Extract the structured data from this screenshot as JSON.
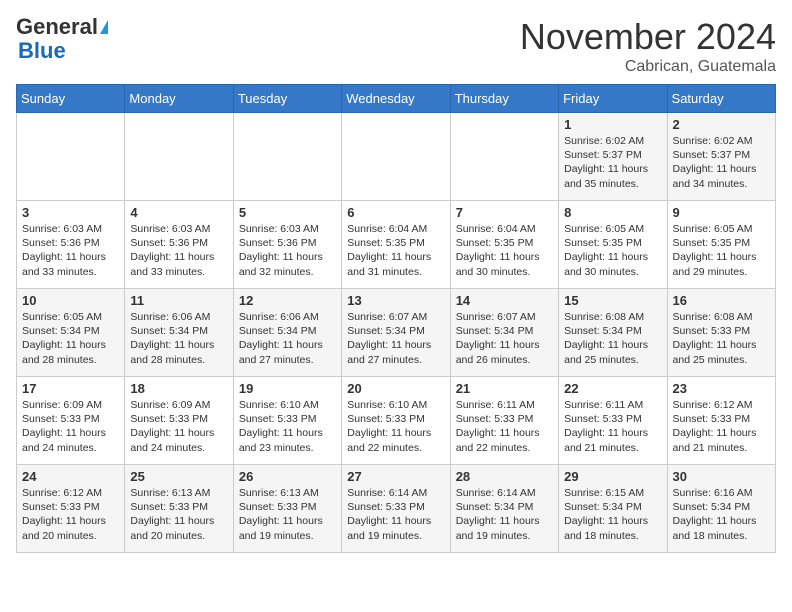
{
  "logo": {
    "general": "General",
    "blue": "Blue"
  },
  "header": {
    "month": "November 2024",
    "location": "Cabrican, Guatemala"
  },
  "weekdays": [
    "Sunday",
    "Monday",
    "Tuesday",
    "Wednesday",
    "Thursday",
    "Friday",
    "Saturday"
  ],
  "weeks": [
    [
      {
        "day": "",
        "info": ""
      },
      {
        "day": "",
        "info": ""
      },
      {
        "day": "",
        "info": ""
      },
      {
        "day": "",
        "info": ""
      },
      {
        "day": "",
        "info": ""
      },
      {
        "day": "1",
        "info": "Sunrise: 6:02 AM\nSunset: 5:37 PM\nDaylight: 11 hours and 35 minutes."
      },
      {
        "day": "2",
        "info": "Sunrise: 6:02 AM\nSunset: 5:37 PM\nDaylight: 11 hours and 34 minutes."
      }
    ],
    [
      {
        "day": "3",
        "info": "Sunrise: 6:03 AM\nSunset: 5:36 PM\nDaylight: 11 hours and 33 minutes."
      },
      {
        "day": "4",
        "info": "Sunrise: 6:03 AM\nSunset: 5:36 PM\nDaylight: 11 hours and 33 minutes."
      },
      {
        "day": "5",
        "info": "Sunrise: 6:03 AM\nSunset: 5:36 PM\nDaylight: 11 hours and 32 minutes."
      },
      {
        "day": "6",
        "info": "Sunrise: 6:04 AM\nSunset: 5:35 PM\nDaylight: 11 hours and 31 minutes."
      },
      {
        "day": "7",
        "info": "Sunrise: 6:04 AM\nSunset: 5:35 PM\nDaylight: 11 hours and 30 minutes."
      },
      {
        "day": "8",
        "info": "Sunrise: 6:05 AM\nSunset: 5:35 PM\nDaylight: 11 hours and 30 minutes."
      },
      {
        "day": "9",
        "info": "Sunrise: 6:05 AM\nSunset: 5:35 PM\nDaylight: 11 hours and 29 minutes."
      }
    ],
    [
      {
        "day": "10",
        "info": "Sunrise: 6:05 AM\nSunset: 5:34 PM\nDaylight: 11 hours and 28 minutes."
      },
      {
        "day": "11",
        "info": "Sunrise: 6:06 AM\nSunset: 5:34 PM\nDaylight: 11 hours and 28 minutes."
      },
      {
        "day": "12",
        "info": "Sunrise: 6:06 AM\nSunset: 5:34 PM\nDaylight: 11 hours and 27 minutes."
      },
      {
        "day": "13",
        "info": "Sunrise: 6:07 AM\nSunset: 5:34 PM\nDaylight: 11 hours and 27 minutes."
      },
      {
        "day": "14",
        "info": "Sunrise: 6:07 AM\nSunset: 5:34 PM\nDaylight: 11 hours and 26 minutes."
      },
      {
        "day": "15",
        "info": "Sunrise: 6:08 AM\nSunset: 5:34 PM\nDaylight: 11 hours and 25 minutes."
      },
      {
        "day": "16",
        "info": "Sunrise: 6:08 AM\nSunset: 5:33 PM\nDaylight: 11 hours and 25 minutes."
      }
    ],
    [
      {
        "day": "17",
        "info": "Sunrise: 6:09 AM\nSunset: 5:33 PM\nDaylight: 11 hours and 24 minutes."
      },
      {
        "day": "18",
        "info": "Sunrise: 6:09 AM\nSunset: 5:33 PM\nDaylight: 11 hours and 24 minutes."
      },
      {
        "day": "19",
        "info": "Sunrise: 6:10 AM\nSunset: 5:33 PM\nDaylight: 11 hours and 23 minutes."
      },
      {
        "day": "20",
        "info": "Sunrise: 6:10 AM\nSunset: 5:33 PM\nDaylight: 11 hours and 22 minutes."
      },
      {
        "day": "21",
        "info": "Sunrise: 6:11 AM\nSunset: 5:33 PM\nDaylight: 11 hours and 22 minutes."
      },
      {
        "day": "22",
        "info": "Sunrise: 6:11 AM\nSunset: 5:33 PM\nDaylight: 11 hours and 21 minutes."
      },
      {
        "day": "23",
        "info": "Sunrise: 6:12 AM\nSunset: 5:33 PM\nDaylight: 11 hours and 21 minutes."
      }
    ],
    [
      {
        "day": "24",
        "info": "Sunrise: 6:12 AM\nSunset: 5:33 PM\nDaylight: 11 hours and 20 minutes."
      },
      {
        "day": "25",
        "info": "Sunrise: 6:13 AM\nSunset: 5:33 PM\nDaylight: 11 hours and 20 minutes."
      },
      {
        "day": "26",
        "info": "Sunrise: 6:13 AM\nSunset: 5:33 PM\nDaylight: 11 hours and 19 minutes."
      },
      {
        "day": "27",
        "info": "Sunrise: 6:14 AM\nSunset: 5:33 PM\nDaylight: 11 hours and 19 minutes."
      },
      {
        "day": "28",
        "info": "Sunrise: 6:14 AM\nSunset: 5:34 PM\nDaylight: 11 hours and 19 minutes."
      },
      {
        "day": "29",
        "info": "Sunrise: 6:15 AM\nSunset: 5:34 PM\nDaylight: 11 hours and 18 minutes."
      },
      {
        "day": "30",
        "info": "Sunrise: 6:16 AM\nSunset: 5:34 PM\nDaylight: 11 hours and 18 minutes."
      }
    ]
  ]
}
